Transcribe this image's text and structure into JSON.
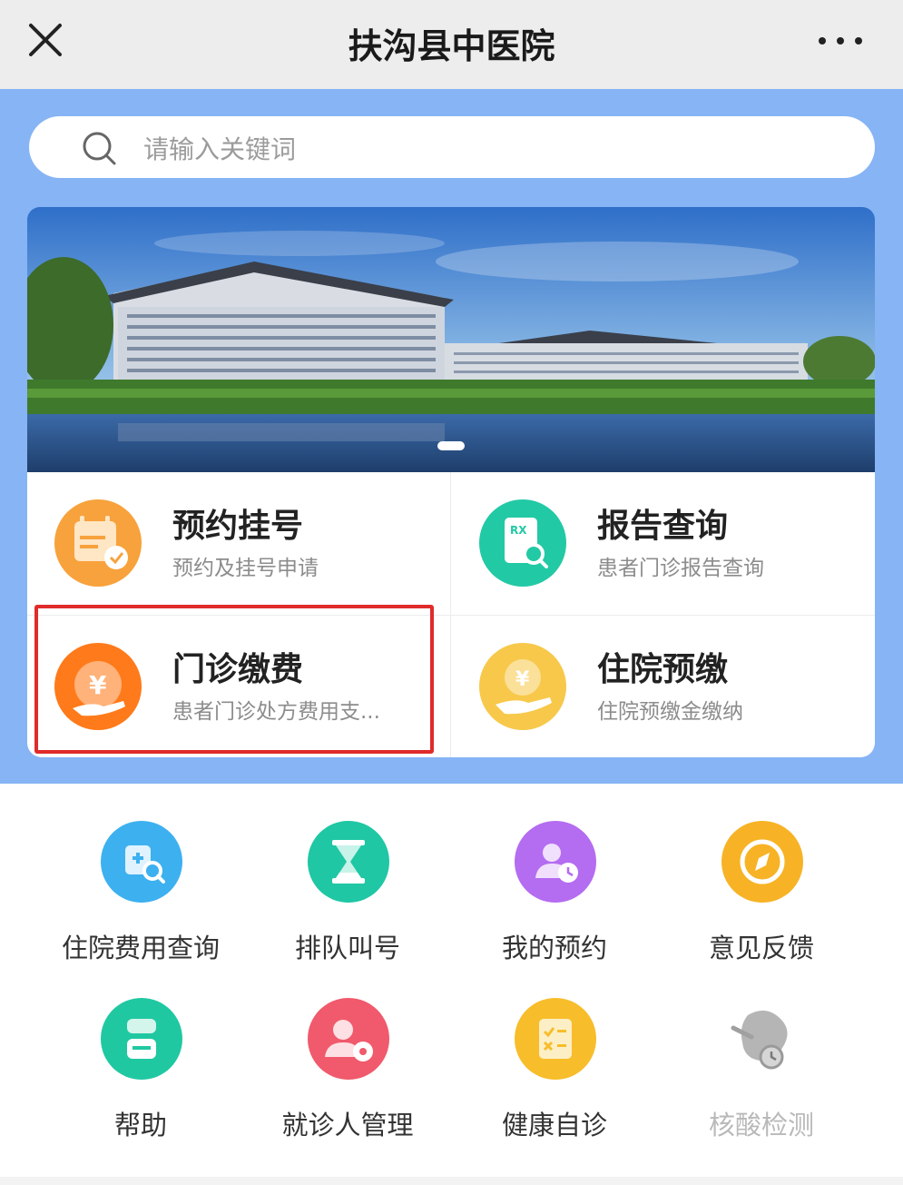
{
  "header": {
    "title": "扶沟县中医院",
    "close_icon": "close-icon",
    "more_icon": "more-dots-icon"
  },
  "search": {
    "placeholder": "请输入关键词",
    "icon": "search-icon"
  },
  "banner": {
    "image": "hospital-building-photo",
    "slide_indicator": "1 of 1"
  },
  "quick_services": [
    {
      "title": "预约挂号",
      "subtitle": "预约及挂号申请",
      "icon": "calendar-check-icon",
      "color": "#f7a23c"
    },
    {
      "title": "报告查询",
      "subtitle": "患者门诊报告查询",
      "icon": "rx-report-icon",
      "color": "#22c9a5"
    },
    {
      "title": "门诊缴费",
      "subtitle": "患者门诊处方费用支...",
      "icon": "yen-hand-icon",
      "color": "#ff7a1a",
      "highlighted": true
    },
    {
      "title": "住院预缴",
      "subtitle": "住院预缴金缴纳",
      "icon": "yen-coin-hand-icon",
      "color": "#f7c84a"
    }
  ],
  "menu": [
    {
      "label": "住院费用查询",
      "icon": "medical-search-icon",
      "color": "#3db0f0"
    },
    {
      "label": "排队叫号",
      "icon": "hourglass-icon",
      "color": "#1fc7a4"
    },
    {
      "label": "我的预约",
      "icon": "user-clock-icon",
      "color": "#b46cf0"
    },
    {
      "label": "意见反馈",
      "icon": "compass-icon",
      "color": "#f7b325"
    },
    {
      "label": "帮助",
      "icon": "help-list-icon",
      "color": "#20c8a2"
    },
    {
      "label": "就诊人管理",
      "icon": "user-gear-icon",
      "color": "#f05a6c"
    },
    {
      "label": "健康自诊",
      "icon": "checklist-icon",
      "color": "#f7bd2a"
    },
    {
      "label": "核酸检测",
      "icon": "virus-test-icon",
      "color": "#8c8c8c",
      "disabled": true
    }
  ]
}
